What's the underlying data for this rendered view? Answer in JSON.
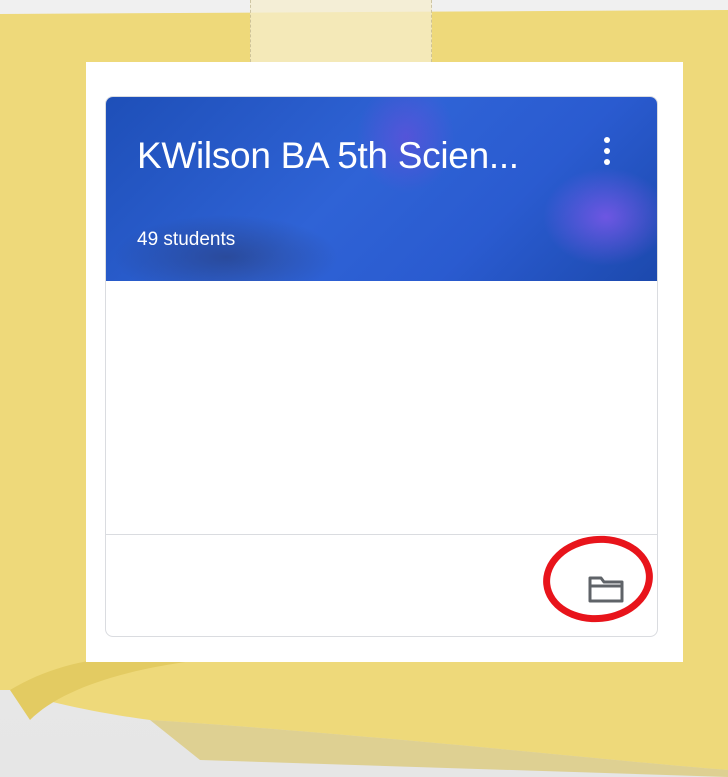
{
  "class_card": {
    "title": "KWilson BA 5th Scien...",
    "students": "49 students",
    "menu_icon": "more-vert-icon",
    "folder_icon": "folder-icon"
  },
  "colors": {
    "sticky_note": "#eed97a",
    "banner": "#2a5bd0",
    "annotation_circle": "#e8141b"
  }
}
